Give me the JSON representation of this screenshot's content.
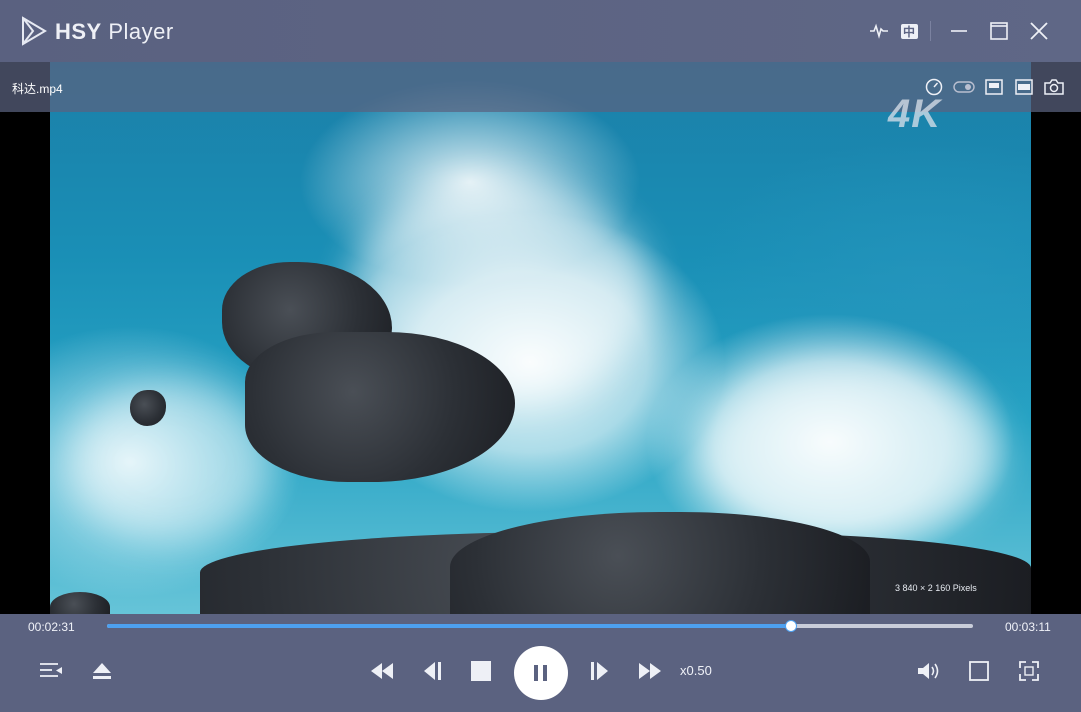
{
  "window": {
    "title_bold": "HSY",
    "title_rest": " Player"
  },
  "titlebar": {
    "buttons": [
      {
        "name": "waveform-icon"
      },
      {
        "name": "chinese-language-icon",
        "label": "中"
      },
      {
        "name": "minimize-icon"
      },
      {
        "name": "maximize-icon"
      },
      {
        "name": "close-icon"
      }
    ]
  },
  "video": {
    "filename": "科达.mp4",
    "quality_badge": "4K",
    "resolution": "3 840 × 2 160 Pixels",
    "overlay_icons": [
      "speedometer-icon",
      "toggle-icon",
      "window-mode-icon",
      "widescreen-icon",
      "camera-icon"
    ]
  },
  "playback": {
    "current_time": "00:02:31",
    "total_time": "00:03:11",
    "progress_fraction": 0.79,
    "speed": "x0.50",
    "state": "playing"
  },
  "controls": {
    "left": [
      "playlist-icon",
      "eject-icon"
    ],
    "center": [
      "rewind-icon",
      "previous-frame-icon",
      "stop-icon",
      "pause-icon",
      "next-frame-icon",
      "fast-forward-icon"
    ],
    "right": [
      "volume-icon",
      "aspect-icon",
      "fullscreen-icon"
    ]
  },
  "colors": {
    "chrome": "#5b6280",
    "progress": "#4da0f0",
    "text": "#f0f2f8"
  }
}
